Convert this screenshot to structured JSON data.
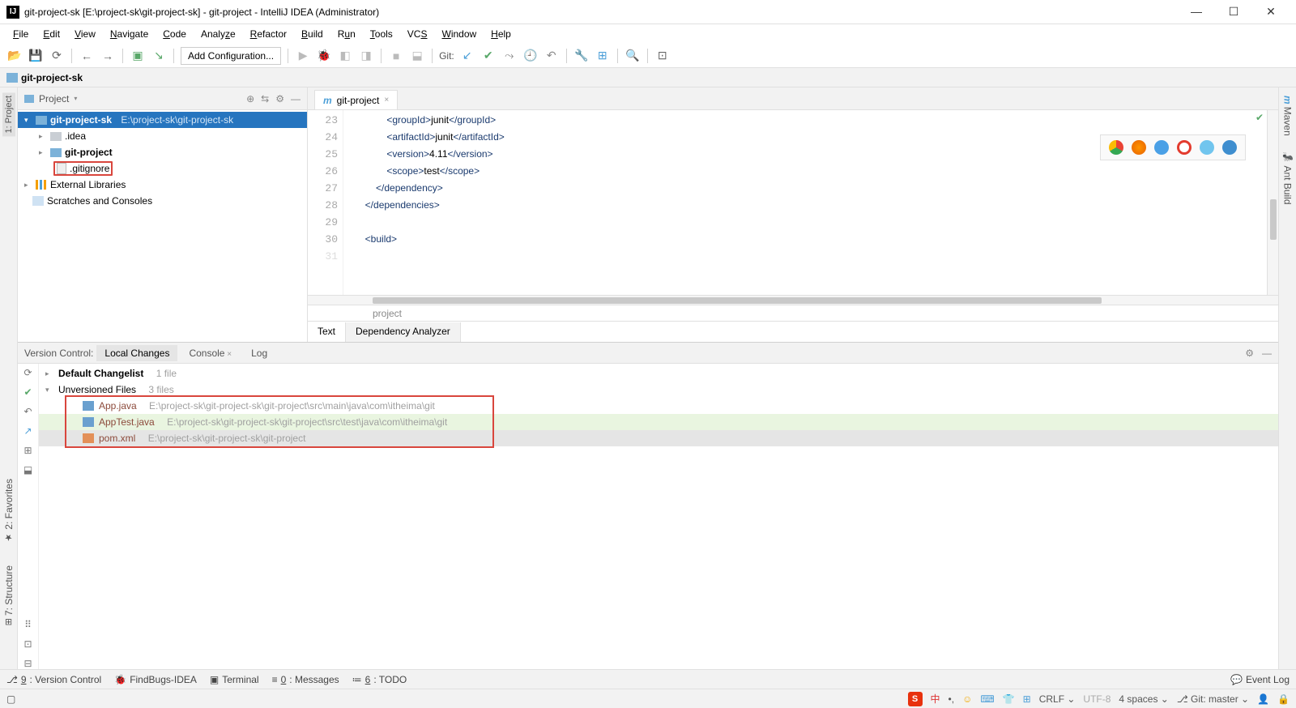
{
  "titlebar": {
    "text": "git-project-sk [E:\\project-sk\\git-project-sk] - git-project - IntelliJ IDEA (Administrator)"
  },
  "menubar": [
    "File",
    "Edit",
    "View",
    "Navigate",
    "Code",
    "Analyze",
    "Refactor",
    "Build",
    "Run",
    "Tools",
    "VCS",
    "Window",
    "Help"
  ],
  "toolbar": {
    "addConfig": "Add Configuration...",
    "gitLabel": "Git:"
  },
  "breadcrumb": {
    "root": "git-project-sk"
  },
  "projectPanel": {
    "title": "Project",
    "root": {
      "name": "git-project-sk",
      "path": "E:\\project-sk\\git-project-sk"
    },
    "idea": ".idea",
    "gitproject": "git-project",
    "gitignore": ".gitignore",
    "extLib": "External Libraries",
    "scratches": "Scratches and Consoles"
  },
  "editor": {
    "tab": "git-project",
    "linesStart": 23,
    "lines": [
      "                <groupId>junit</groupId>",
      "                <artifactId>junit</artifactId>",
      "                <version>4.11</version>",
      "                <scope>test</scope>",
      "            </dependency>",
      "        </dependencies>",
      "",
      "        <build>",
      ""
    ],
    "crumb": "project",
    "bottomTabs": {
      "text": "Text",
      "dep": "Dependency Analyzer"
    }
  },
  "sideTabs": {
    "left1": "1: Project",
    "leftFav": "2: Favorites",
    "leftStr": "7: Structure",
    "rightMaven": "Maven",
    "rightAnt": "Ant Build"
  },
  "vcPanel": {
    "label": "Version Control:",
    "tabs": {
      "local": "Local Changes",
      "console": "Console",
      "log": "Log"
    },
    "defaultCl": {
      "name": "Default Changelist",
      "count": "1 file"
    },
    "unversioned": {
      "name": "Unversioned Files",
      "count": "3 files"
    },
    "files": [
      {
        "name": "App.java",
        "path": "E:\\project-sk\\git-project-sk\\git-project\\src\\main\\java\\com\\itheima\\git"
      },
      {
        "name": "AppTest.java",
        "path": "E:\\project-sk\\git-project-sk\\git-project\\src\\test\\java\\com\\itheima\\git"
      },
      {
        "name": "pom.xml",
        "path": "E:\\project-sk\\git-project-sk\\git-project"
      }
    ]
  },
  "bottomBar": {
    "vc": "9: Version Control",
    "findbugs": "FindBugs-IDEA",
    "terminal": "Terminal",
    "messages": "0: Messages",
    "todo": "6: TODO",
    "eventLog": "Event Log"
  },
  "statusBar": {
    "crlf": "CRLF",
    "enc": "UTF-8",
    "spaces": "4 spaces",
    "branch": "Git: master"
  }
}
